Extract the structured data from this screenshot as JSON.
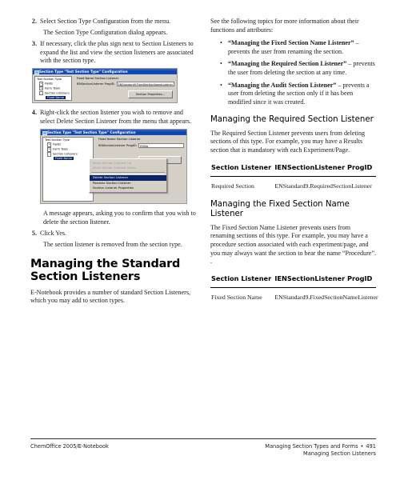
{
  "document": {
    "left_column": {
      "steps": [
        {
          "number": "2.",
          "text": "Select Section Type Configuration from the menu.",
          "result": "The Section Type Configuration dialog appears."
        },
        {
          "number": "3.",
          "text": "If necessary, click the plus sign next to Section Listeners to expand the list and view the section listeners are associated with the section type.",
          "result": ""
        },
        {
          "number": "4.",
          "text": "Right-click the section listener you wish to remove and select Delete Section Listener from the menu that appears.",
          "result": "A message appears, asking you to confirm that you wish to delete the section listener."
        },
        {
          "number": "5.",
          "text": "Click Yes.",
          "result": "The section listener is removed from the section type."
        }
      ],
      "heading": "Managing the Standard Section Listeners",
      "heading_body": "E-Notebook provides a number of standard Section Listeners, which you may add to section types."
    },
    "screenshot_1": {
      "title": "Section Type \"Test Section Type\" Configuration",
      "tree_label": "Test Section Type",
      "tree_items": [
        {
          "label": "Fields",
          "toggle": "+",
          "level": 1,
          "selected": false
        },
        {
          "label": "Form Tools",
          "toggle": "+",
          "level": 1,
          "selected": false
        },
        {
          "label": "Section Listeners",
          "toggle": "-",
          "level": 1,
          "selected": false
        },
        {
          "label": "Fixed Name",
          "toggle": "",
          "level": 2,
          "selected": true
        }
      ],
      "group_label": "Fixed Name Section Listener",
      "field_label": "IENSectionListener ProgID:",
      "field_value": "ENStandard9.FixedSectionNameListener",
      "button_label": "Section Properties..."
    },
    "screenshot_2": {
      "title": "Section Type \"Test Section Type\" Configuration",
      "tree_label": "Test Section Type",
      "tree_items": [
        {
          "label": "Fields",
          "toggle": "+",
          "level": 1,
          "selected": false
        },
        {
          "label": "Form Tools",
          "toggle": "+",
          "level": 1,
          "selected": false
        },
        {
          "label": "Section Listeners",
          "toggle": "-",
          "level": 1,
          "selected": false
        },
        {
          "label": "Fixed Name",
          "toggle": "",
          "level": 2,
          "selected": true
        }
      ],
      "group_label": "Fixed Name Section Listener",
      "field_label": "IENSectionListener ProgID:",
      "field_value": "ENSta",
      "button_label": "",
      "context_menu": [
        {
          "label": "Move Section Listener Up",
          "state": "disabled"
        },
        {
          "label": "Move Section Listener Down",
          "state": "disabled"
        },
        {
          "label": "Delete Section Listener",
          "state": "highlighted"
        },
        {
          "label": "Rename Section Listener",
          "state": "normal"
        },
        {
          "label": "Section Listener Properties",
          "state": "normal"
        }
      ]
    },
    "right_column": {
      "intro": "See the following topics for more information about their functions and attributes:",
      "bullets": [
        {
          "bold": "“Managing the Fixed Section Name Listener”",
          "rest": " – prevents the user from renaming the section."
        },
        {
          "bold": "“Managing the Required Section Listener”",
          "rest": " – prevents the user from deleting the section at any time."
        },
        {
          "bold": "“Managing the Audit Section Listener”",
          "rest": " – prevents a user from deleting the section only if it has been modified since it was created."
        }
      ],
      "section_required": {
        "heading": "Managing the Required Section Listener",
        "body": "The Required Section Listener prevents users from deleting sections of this type. For example, you may have a Results section that is mandatory with each Experiment/Page.",
        "table": {
          "headers": [
            "Section Listener",
            "IENSectionListener ProgID"
          ],
          "rows": [
            [
              "Required Section",
              "ENStandard9.RequiredSectionListener"
            ]
          ]
        }
      },
      "section_fixed": {
        "heading": "Managing the Fixed Section Name Listener",
        "body": "The Fixed Section Name Listener prevents users from renaming sections of this type. For example, you may have a procedure section associated with each experiment/page, and you may always want the section to bear the name “Procedure”. .",
        "table": {
          "headers": [
            "Section Listener",
            "IENSectionListener ProgID"
          ],
          "rows": [
            [
              "Fixed Section Name",
              "ENStandard9.FixedSectionNameListener"
            ]
          ]
        }
      }
    },
    "footer": {
      "left": "ChemOffice 2005/E-Notebook",
      "right_line1": "Managing Section Types and Forms",
      "right_line2": "Managing Section Listeners",
      "bullet": "•",
      "page_number": "491"
    }
  }
}
